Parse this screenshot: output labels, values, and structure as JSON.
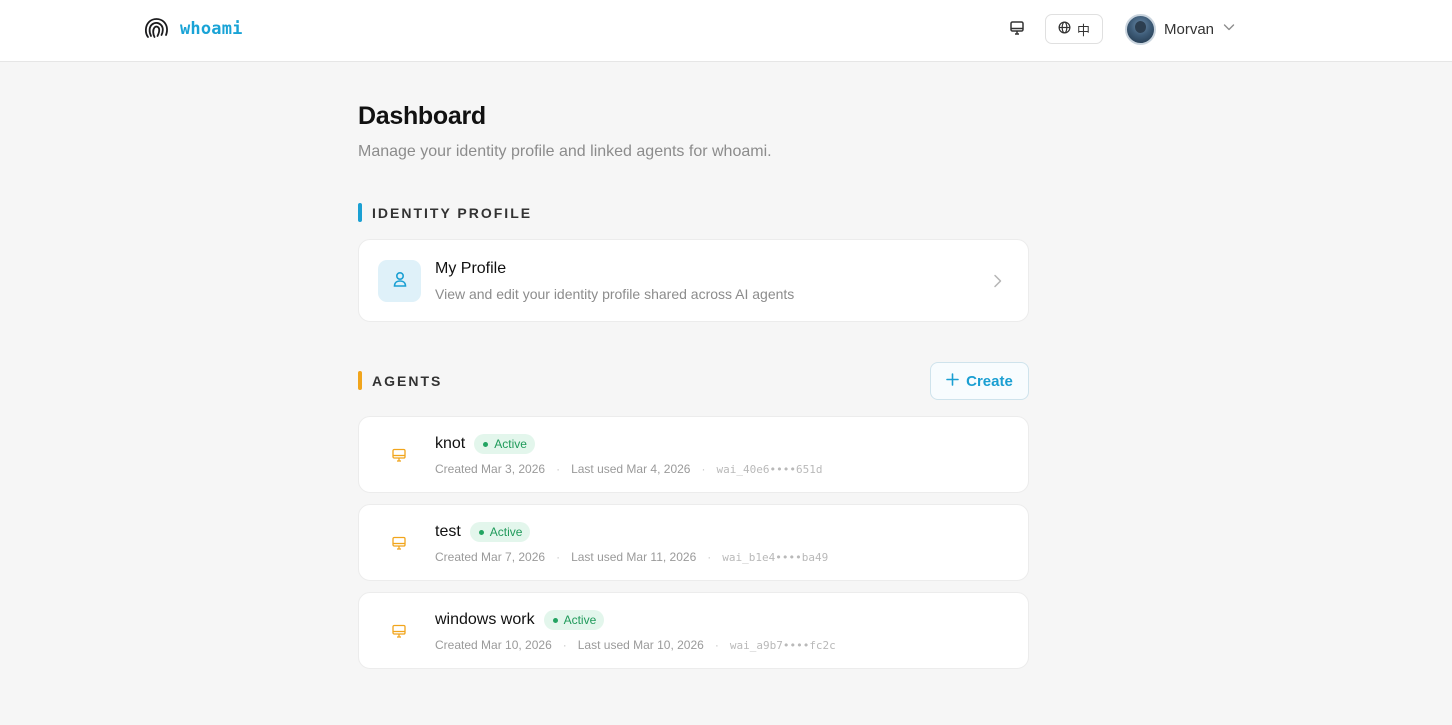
{
  "header": {
    "brand_name": "whoami",
    "lang_label": "中",
    "user_name": "Morvan"
  },
  "page": {
    "title": "Dashboard",
    "subtitle": "Manage your identity profile and linked agents for whoami."
  },
  "identity_section": {
    "label": "IDENTITY PROFILE",
    "accent": "#1ba0d3",
    "profile_card": {
      "title": "My Profile",
      "description": "View and edit your identity profile shared across AI agents"
    }
  },
  "agents_section": {
    "label": "AGENTS",
    "accent": "#f1a51c",
    "create_label": "Create",
    "agents": [
      {
        "name": "knot",
        "status": "Active",
        "created": "Created Mar 3, 2026",
        "last_used": "Last used Mar 4, 2026",
        "key": "wai_40e6••••651d"
      },
      {
        "name": "test",
        "status": "Active",
        "created": "Created Mar 7, 2026",
        "last_used": "Last used Mar 11, 2026",
        "key": "wai_b1e4••••ba49"
      },
      {
        "name": "windows work",
        "status": "Active",
        "created": "Created Mar 10, 2026",
        "last_used": "Last used Mar 10, 2026",
        "key": "wai_a9b7••••fc2c"
      }
    ]
  },
  "icons": {
    "brand": "fingerprint-icon",
    "display": "monitor-icon",
    "language": "globe-icon",
    "user_menu": "chevron-down-icon",
    "profile": "user-icon",
    "profile_open": "chevron-right-icon",
    "create": "plus-icon",
    "agent": "monitor-icon"
  }
}
